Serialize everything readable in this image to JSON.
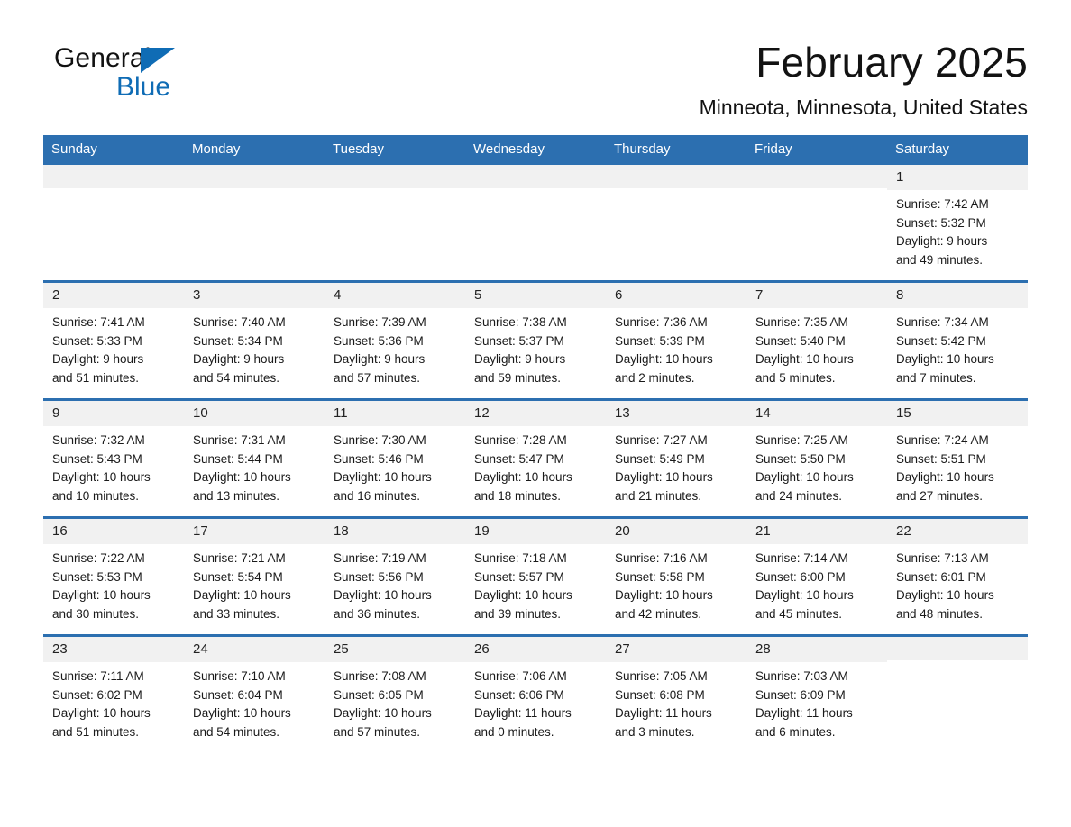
{
  "brand": {
    "name_part1": "General",
    "name_part2": "Blue",
    "logo_icon": "blue-triangle-icon",
    "accent_color": "#0f6cb5"
  },
  "header": {
    "title": "February 2025",
    "subtitle": "Minneota, Minnesota, United States"
  },
  "theme": {
    "header_blue": "#2c6fb0",
    "day_band_gray": "#f1f1f1",
    "page_background": "#ffffff"
  },
  "calendar": {
    "weekday_headers": [
      "Sunday",
      "Monday",
      "Tuesday",
      "Wednesday",
      "Thursday",
      "Friday",
      "Saturday"
    ],
    "weeks": [
      [
        {
          "date": "",
          "sunrise": "",
          "sunset": "",
          "daylight_line1": "",
          "daylight_line2": ""
        },
        {
          "date": "",
          "sunrise": "",
          "sunset": "",
          "daylight_line1": "",
          "daylight_line2": ""
        },
        {
          "date": "",
          "sunrise": "",
          "sunset": "",
          "daylight_line1": "",
          "daylight_line2": ""
        },
        {
          "date": "",
          "sunrise": "",
          "sunset": "",
          "daylight_line1": "",
          "daylight_line2": ""
        },
        {
          "date": "",
          "sunrise": "",
          "sunset": "",
          "daylight_line1": "",
          "daylight_line2": ""
        },
        {
          "date": "",
          "sunrise": "",
          "sunset": "",
          "daylight_line1": "",
          "daylight_line2": ""
        },
        {
          "date": "1",
          "sunrise": "Sunrise: 7:42 AM",
          "sunset": "Sunset: 5:32 PM",
          "daylight_line1": "Daylight: 9 hours",
          "daylight_line2": "and 49 minutes."
        }
      ],
      [
        {
          "date": "2",
          "sunrise": "Sunrise: 7:41 AM",
          "sunset": "Sunset: 5:33 PM",
          "daylight_line1": "Daylight: 9 hours",
          "daylight_line2": "and 51 minutes."
        },
        {
          "date": "3",
          "sunrise": "Sunrise: 7:40 AM",
          "sunset": "Sunset: 5:34 PM",
          "daylight_line1": "Daylight: 9 hours",
          "daylight_line2": "and 54 minutes."
        },
        {
          "date": "4",
          "sunrise": "Sunrise: 7:39 AM",
          "sunset": "Sunset: 5:36 PM",
          "daylight_line1": "Daylight: 9 hours",
          "daylight_line2": "and 57 minutes."
        },
        {
          "date": "5",
          "sunrise": "Sunrise: 7:38 AM",
          "sunset": "Sunset: 5:37 PM",
          "daylight_line1": "Daylight: 9 hours",
          "daylight_line2": "and 59 minutes."
        },
        {
          "date": "6",
          "sunrise": "Sunrise: 7:36 AM",
          "sunset": "Sunset: 5:39 PM",
          "daylight_line1": "Daylight: 10 hours",
          "daylight_line2": "and 2 minutes."
        },
        {
          "date": "7",
          "sunrise": "Sunrise: 7:35 AM",
          "sunset": "Sunset: 5:40 PM",
          "daylight_line1": "Daylight: 10 hours",
          "daylight_line2": "and 5 minutes."
        },
        {
          "date": "8",
          "sunrise": "Sunrise: 7:34 AM",
          "sunset": "Sunset: 5:42 PM",
          "daylight_line1": "Daylight: 10 hours",
          "daylight_line2": "and 7 minutes."
        }
      ],
      [
        {
          "date": "9",
          "sunrise": "Sunrise: 7:32 AM",
          "sunset": "Sunset: 5:43 PM",
          "daylight_line1": "Daylight: 10 hours",
          "daylight_line2": "and 10 minutes."
        },
        {
          "date": "10",
          "sunrise": "Sunrise: 7:31 AM",
          "sunset": "Sunset: 5:44 PM",
          "daylight_line1": "Daylight: 10 hours",
          "daylight_line2": "and 13 minutes."
        },
        {
          "date": "11",
          "sunrise": "Sunrise: 7:30 AM",
          "sunset": "Sunset: 5:46 PM",
          "daylight_line1": "Daylight: 10 hours",
          "daylight_line2": "and 16 minutes."
        },
        {
          "date": "12",
          "sunrise": "Sunrise: 7:28 AM",
          "sunset": "Sunset: 5:47 PM",
          "daylight_line1": "Daylight: 10 hours",
          "daylight_line2": "and 18 minutes."
        },
        {
          "date": "13",
          "sunrise": "Sunrise: 7:27 AM",
          "sunset": "Sunset: 5:49 PM",
          "daylight_line1": "Daylight: 10 hours",
          "daylight_line2": "and 21 minutes."
        },
        {
          "date": "14",
          "sunrise": "Sunrise: 7:25 AM",
          "sunset": "Sunset: 5:50 PM",
          "daylight_line1": "Daylight: 10 hours",
          "daylight_line2": "and 24 minutes."
        },
        {
          "date": "15",
          "sunrise": "Sunrise: 7:24 AM",
          "sunset": "Sunset: 5:51 PM",
          "daylight_line1": "Daylight: 10 hours",
          "daylight_line2": "and 27 minutes."
        }
      ],
      [
        {
          "date": "16",
          "sunrise": "Sunrise: 7:22 AM",
          "sunset": "Sunset: 5:53 PM",
          "daylight_line1": "Daylight: 10 hours",
          "daylight_line2": "and 30 minutes."
        },
        {
          "date": "17",
          "sunrise": "Sunrise: 7:21 AM",
          "sunset": "Sunset: 5:54 PM",
          "daylight_line1": "Daylight: 10 hours",
          "daylight_line2": "and 33 minutes."
        },
        {
          "date": "18",
          "sunrise": "Sunrise: 7:19 AM",
          "sunset": "Sunset: 5:56 PM",
          "daylight_line1": "Daylight: 10 hours",
          "daylight_line2": "and 36 minutes."
        },
        {
          "date": "19",
          "sunrise": "Sunrise: 7:18 AM",
          "sunset": "Sunset: 5:57 PM",
          "daylight_line1": "Daylight: 10 hours",
          "daylight_line2": "and 39 minutes."
        },
        {
          "date": "20",
          "sunrise": "Sunrise: 7:16 AM",
          "sunset": "Sunset: 5:58 PM",
          "daylight_line1": "Daylight: 10 hours",
          "daylight_line2": "and 42 minutes."
        },
        {
          "date": "21",
          "sunrise": "Sunrise: 7:14 AM",
          "sunset": "Sunset: 6:00 PM",
          "daylight_line1": "Daylight: 10 hours",
          "daylight_line2": "and 45 minutes."
        },
        {
          "date": "22",
          "sunrise": "Sunrise: 7:13 AM",
          "sunset": "Sunset: 6:01 PM",
          "daylight_line1": "Daylight: 10 hours",
          "daylight_line2": "and 48 minutes."
        }
      ],
      [
        {
          "date": "23",
          "sunrise": "Sunrise: 7:11 AM",
          "sunset": "Sunset: 6:02 PM",
          "daylight_line1": "Daylight: 10 hours",
          "daylight_line2": "and 51 minutes."
        },
        {
          "date": "24",
          "sunrise": "Sunrise: 7:10 AM",
          "sunset": "Sunset: 6:04 PM",
          "daylight_line1": "Daylight: 10 hours",
          "daylight_line2": "and 54 minutes."
        },
        {
          "date": "25",
          "sunrise": "Sunrise: 7:08 AM",
          "sunset": "Sunset: 6:05 PM",
          "daylight_line1": "Daylight: 10 hours",
          "daylight_line2": "and 57 minutes."
        },
        {
          "date": "26",
          "sunrise": "Sunrise: 7:06 AM",
          "sunset": "Sunset: 6:06 PM",
          "daylight_line1": "Daylight: 11 hours",
          "daylight_line2": "and 0 minutes."
        },
        {
          "date": "27",
          "sunrise": "Sunrise: 7:05 AM",
          "sunset": "Sunset: 6:08 PM",
          "daylight_line1": "Daylight: 11 hours",
          "daylight_line2": "and 3 minutes."
        },
        {
          "date": "28",
          "sunrise": "Sunrise: 7:03 AM",
          "sunset": "Sunset: 6:09 PM",
          "daylight_line1": "Daylight: 11 hours",
          "daylight_line2": "and 6 minutes."
        },
        {
          "date": "",
          "sunrise": "",
          "sunset": "",
          "daylight_line1": "",
          "daylight_line2": ""
        }
      ]
    ]
  }
}
